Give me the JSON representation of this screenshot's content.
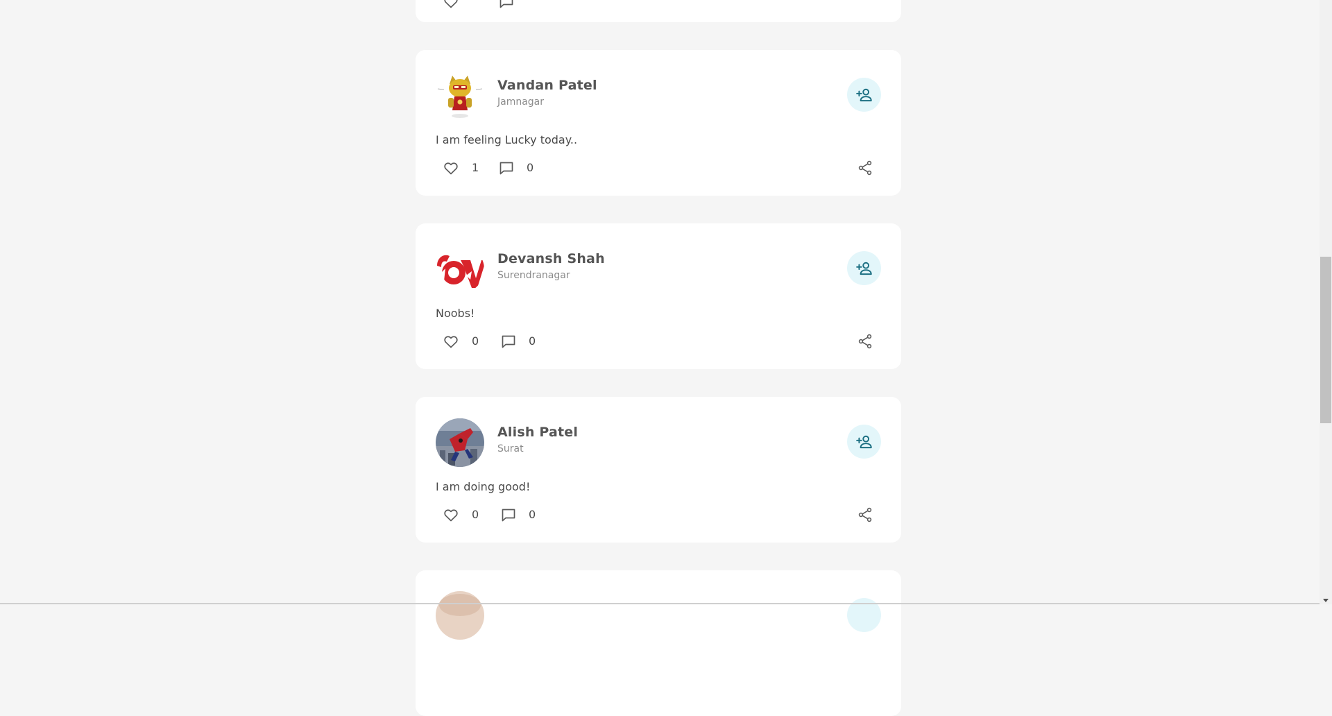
{
  "posts": [
    {
      "name": "Vandan Patel",
      "city": "Jamnagar",
      "text": "I am feeling Lucky today..",
      "likes": "1",
      "comments": "0",
      "avatar_icon": "ironman-cat-avatar"
    },
    {
      "name": "Devansh Shah",
      "city": "Surendranagar",
      "text": "Noobs!",
      "likes": "0",
      "comments": "0",
      "avatar_icon": "red-logo-avatar"
    },
    {
      "name": "Alish Patel",
      "city": "Surat",
      "text": "I am doing good!",
      "likes": "0",
      "comments": "0",
      "avatar_icon": "spiderman-avatar"
    }
  ],
  "colors": {
    "page_bg": "#f5f5f5",
    "card_bg": "#ffffff",
    "follow_btn_bg": "#e3f6fa",
    "follow_icon": "#1b6f82",
    "icon_gray": "#5a5a5a"
  },
  "icons": {
    "follow": "person-add-icon",
    "like": "heart-icon",
    "comment": "comment-icon",
    "share": "share-icon"
  }
}
